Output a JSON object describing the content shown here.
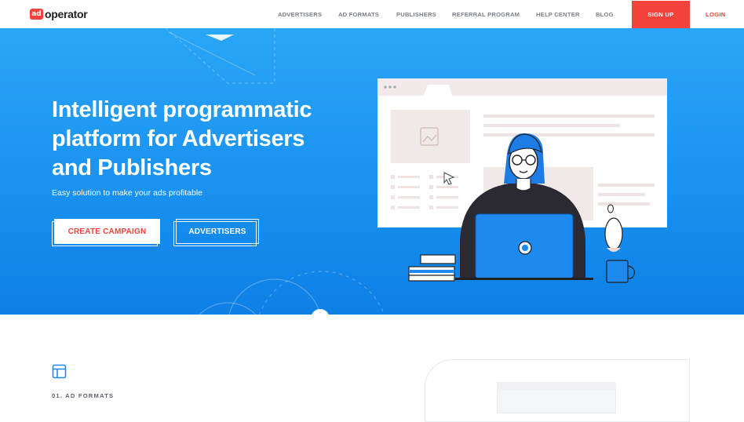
{
  "nav": {
    "logo_mark": "ad",
    "logo_text": "operator",
    "items": [
      {
        "label": "ADVERTISERS"
      },
      {
        "label": "AD FORMATS"
      },
      {
        "label": "PUBLISHERS"
      },
      {
        "label": "REFERRAL PROGRAM"
      },
      {
        "label": "HELP CENTER"
      },
      {
        "label": "BLOG"
      }
    ],
    "signup_label": "SIGN UP",
    "login_label": "LOGIN"
  },
  "hero": {
    "title_line1": "Intelligent programmatic",
    "title_line2": "platform for Advertisers",
    "title_line3": "and Publishers",
    "subtitle": "Easy solution to make your ads profitable",
    "cta_primary": "CREATE CAMPAIGN",
    "cta_secondary": "ADVERTISERS"
  },
  "section": {
    "icon": "layout-icon",
    "label": "01. AD FORMATS"
  },
  "colors": {
    "brand_red": "#f4433a",
    "hero_blue": "#1992f0",
    "text_gray": "#7b7f87"
  }
}
